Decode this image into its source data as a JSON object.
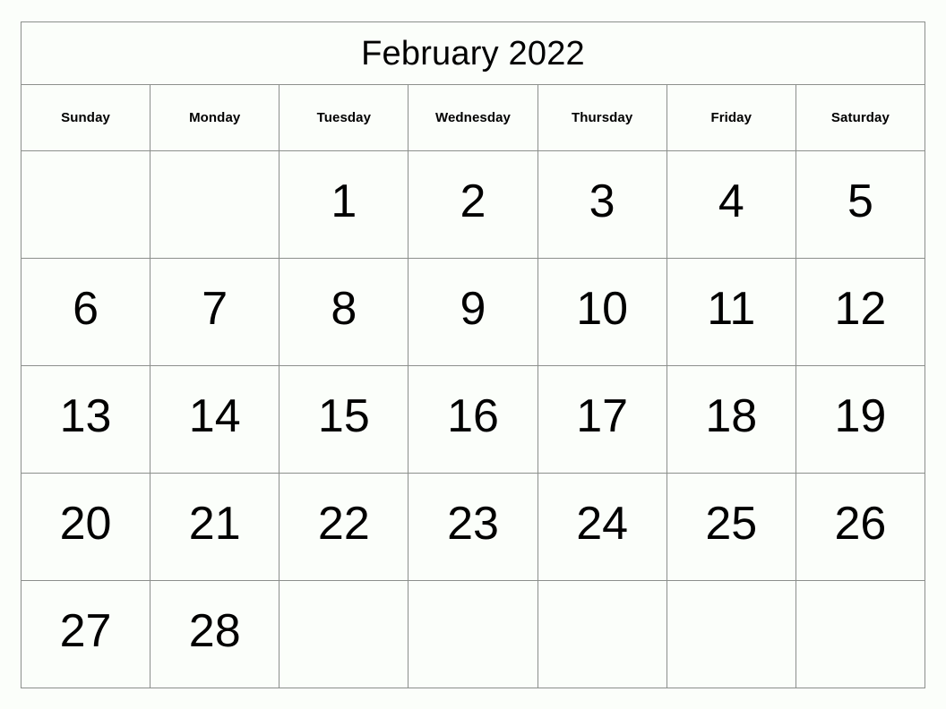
{
  "calendar": {
    "title": "February 2022",
    "month": "February",
    "year": "2022",
    "weekdays": [
      "Sunday",
      "Monday",
      "Tuesday",
      "Wednesday",
      "Thursday",
      "Friday",
      "Saturday"
    ],
    "weeks": [
      [
        "",
        "",
        "1",
        "2",
        "3",
        "4",
        "5"
      ],
      [
        "6",
        "7",
        "8",
        "9",
        "10",
        "11",
        "12"
      ],
      [
        "13",
        "14",
        "15",
        "16",
        "17",
        "18",
        "19"
      ],
      [
        "20",
        "21",
        "22",
        "23",
        "24",
        "25",
        "26"
      ],
      [
        "27",
        "28",
        "",
        "",
        "",
        "",
        ""
      ]
    ],
    "colors": {
      "background": "#fbfefa",
      "border": "#8c8f8c",
      "text": "#000000"
    }
  }
}
